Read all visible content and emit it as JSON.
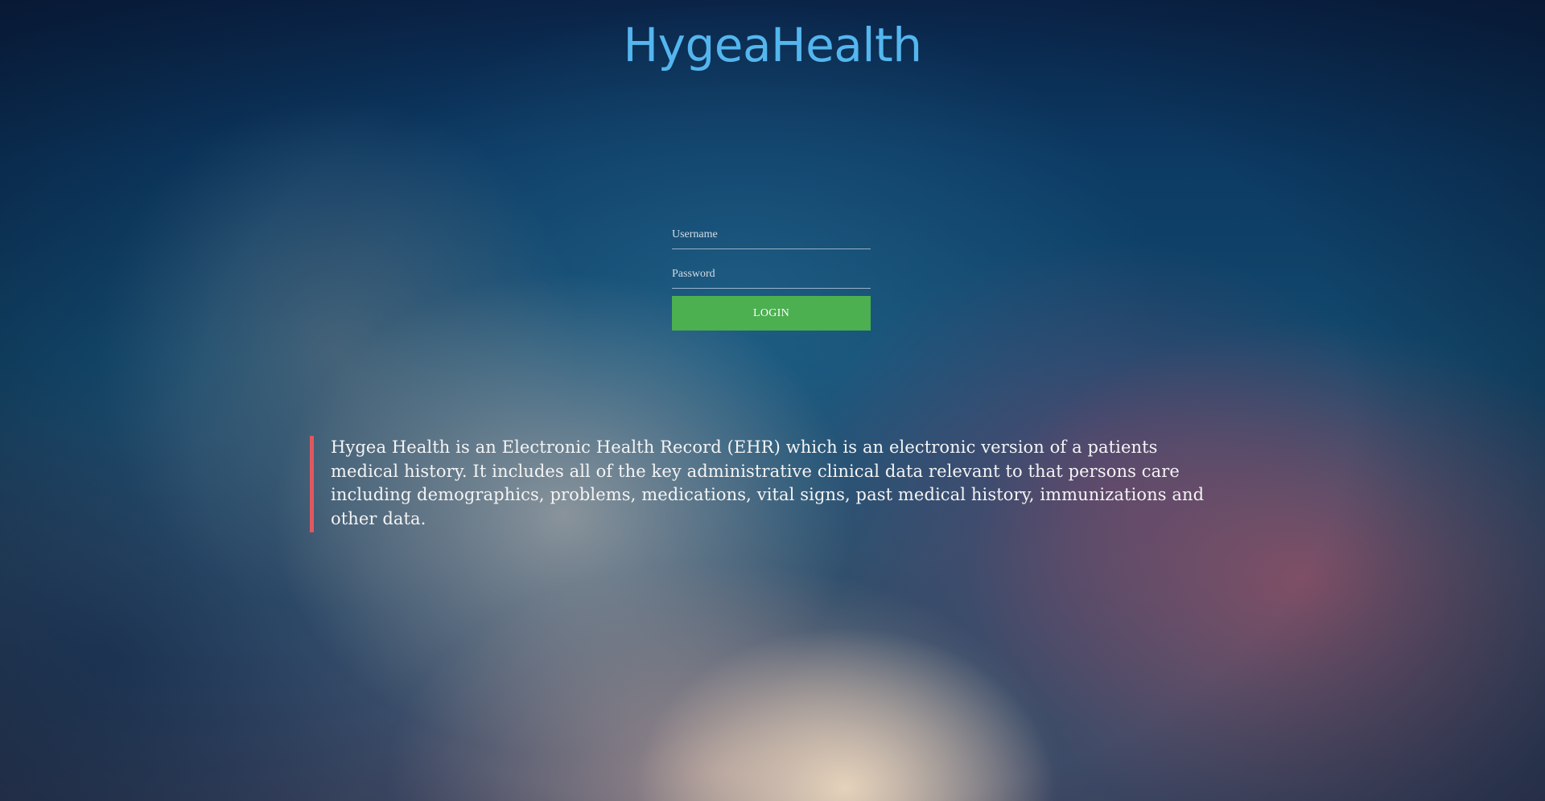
{
  "app": {
    "brand_name": "HygeaHealth"
  },
  "login_form": {
    "username_placeholder": "Username",
    "password_placeholder": "Password",
    "username_value": "",
    "password_value": "",
    "login_label": "LOGIN"
  },
  "description": {
    "text": "Hygea Health is an Electronic Health Record (EHR) which is an electronic version of a patients medical history. It includes all of the key administrative clinical data relevant to that persons care including demographics, problems, medications, vital signs, past medical history, immunizations and other data."
  },
  "colors": {
    "brand": "#54b6ef",
    "login_button": "#4caf50",
    "quote_border": "#e0585f"
  }
}
